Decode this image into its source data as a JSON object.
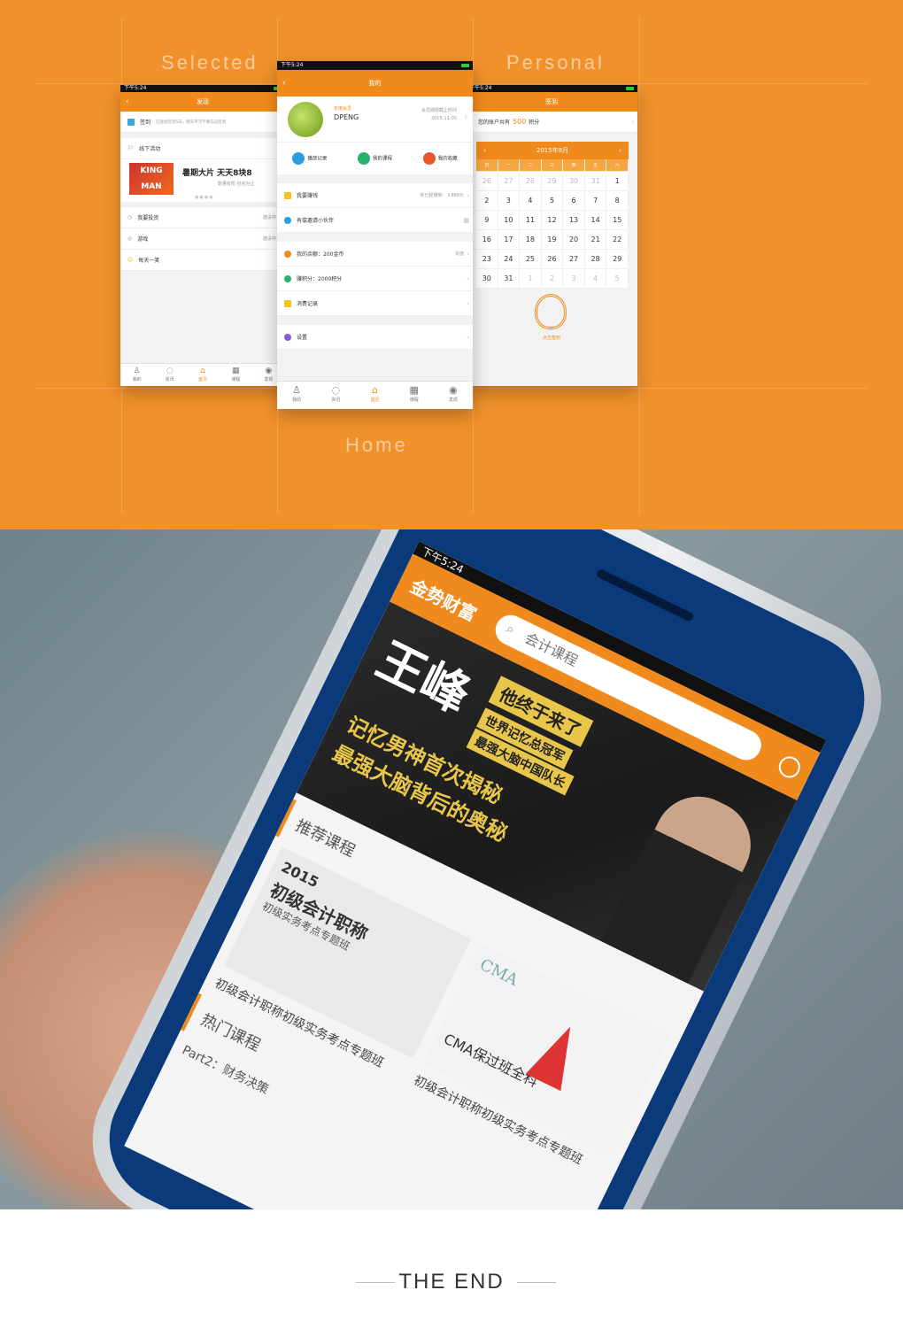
{
  "labels": {
    "selected": "Selected",
    "personal": "Personal",
    "home": "Home"
  },
  "status_time": "下午5:24",
  "left": {
    "title": "发现",
    "checkin": "签到",
    "checkin_hint": "已连续签到5天，明天不万不要忘记签到",
    "offline": "线下活动",
    "banner": "暑期大片 天天8块8",
    "banner_sub": "数量有限 抢完为止",
    "invest": "我要投资",
    "invest_status": "建设中",
    "game": "游戏",
    "game_status": "建设中",
    "joke": "每天一笑"
  },
  "center": {
    "title": "我的",
    "member": "年度会员",
    "name": "DPENG",
    "expire_label": "会员期限截止时间",
    "expire": "2015-11-05",
    "q1": "播放记录",
    "q2": "我的课程",
    "q3": "我的收藏",
    "earn": "我要赚钱",
    "earned": "你已经赚到：￥888元",
    "invite": "有偿邀请小伙伴",
    "balance": "我的余额：200金币",
    "recharge": "充值",
    "points": "赚积分：2000积分",
    "records": "消费记录",
    "settings": "设置"
  },
  "tabs": [
    "我的",
    "资讯",
    "首页",
    "课程",
    "发现"
  ],
  "right": {
    "title": "签到",
    "account": "您的账户共有",
    "points": "500",
    "unit": "积分",
    "month": "2015年8月",
    "weekdays": [
      "日",
      "一",
      "二",
      "三",
      "四",
      "五",
      "六"
    ],
    "days": [
      "26",
      "27",
      "28",
      "29",
      "30",
      "31",
      "1",
      "2",
      "3",
      "4",
      "5",
      "6",
      "7",
      "8",
      "9",
      "10",
      "11",
      "12",
      "13",
      "14",
      "15",
      "16",
      "17",
      "18",
      "19",
      "20",
      "21",
      "22",
      "23",
      "24",
      "25",
      "26",
      "27",
      "28",
      "29",
      "30",
      "31",
      "1",
      "2",
      "3",
      "4",
      "5"
    ],
    "action": "点击签到"
  },
  "photo": {
    "status_time": "下午5:24",
    "brand": "金势财富",
    "search": "会计课程",
    "headline1": "王峰",
    "headline2": "他终于来了",
    "headline3": "世界记忆总冠军",
    "headline4": "最强大脑中国队长",
    "headline5": "记忆男神首次揭秘",
    "headline6": "最强大脑背后的奥秘",
    "section1": "推荐课程",
    "course_tag": "2015",
    "course_banner": "初级会计职称",
    "course_sub": "初级实务考点专题班",
    "course1": "初级会计职称初级实务考点专题班",
    "cma": "CMA",
    "cma_title": "CMA保过班全科",
    "course2": "初级会计职称初级实务考点专题班",
    "section2": "热门课程",
    "part": "Part2：财务决策"
  },
  "end": "THE END"
}
